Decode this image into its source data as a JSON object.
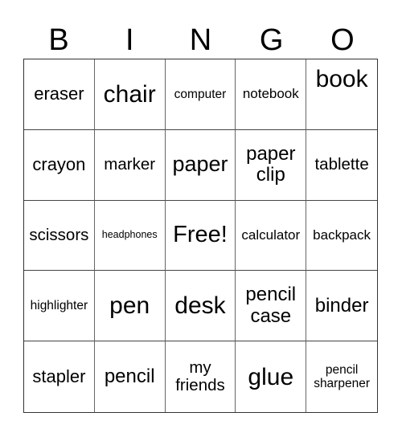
{
  "card": {
    "header": [
      "B",
      "I",
      "N",
      "G",
      "O"
    ],
    "rows": [
      [
        "eraser",
        "chair",
        "computer",
        "notebook",
        "book"
      ],
      [
        "crayon",
        "marker",
        "paper",
        "paper clip",
        "tablette"
      ],
      [
        "scissors",
        "headphones",
        "Free!",
        "calculator",
        "backpack"
      ],
      [
        "highlighter",
        "pen",
        "desk",
        "pencil case",
        "binder"
      ],
      [
        "stapler",
        "pencil",
        "my friends",
        "glue",
        "pencil sharpener"
      ]
    ]
  }
}
